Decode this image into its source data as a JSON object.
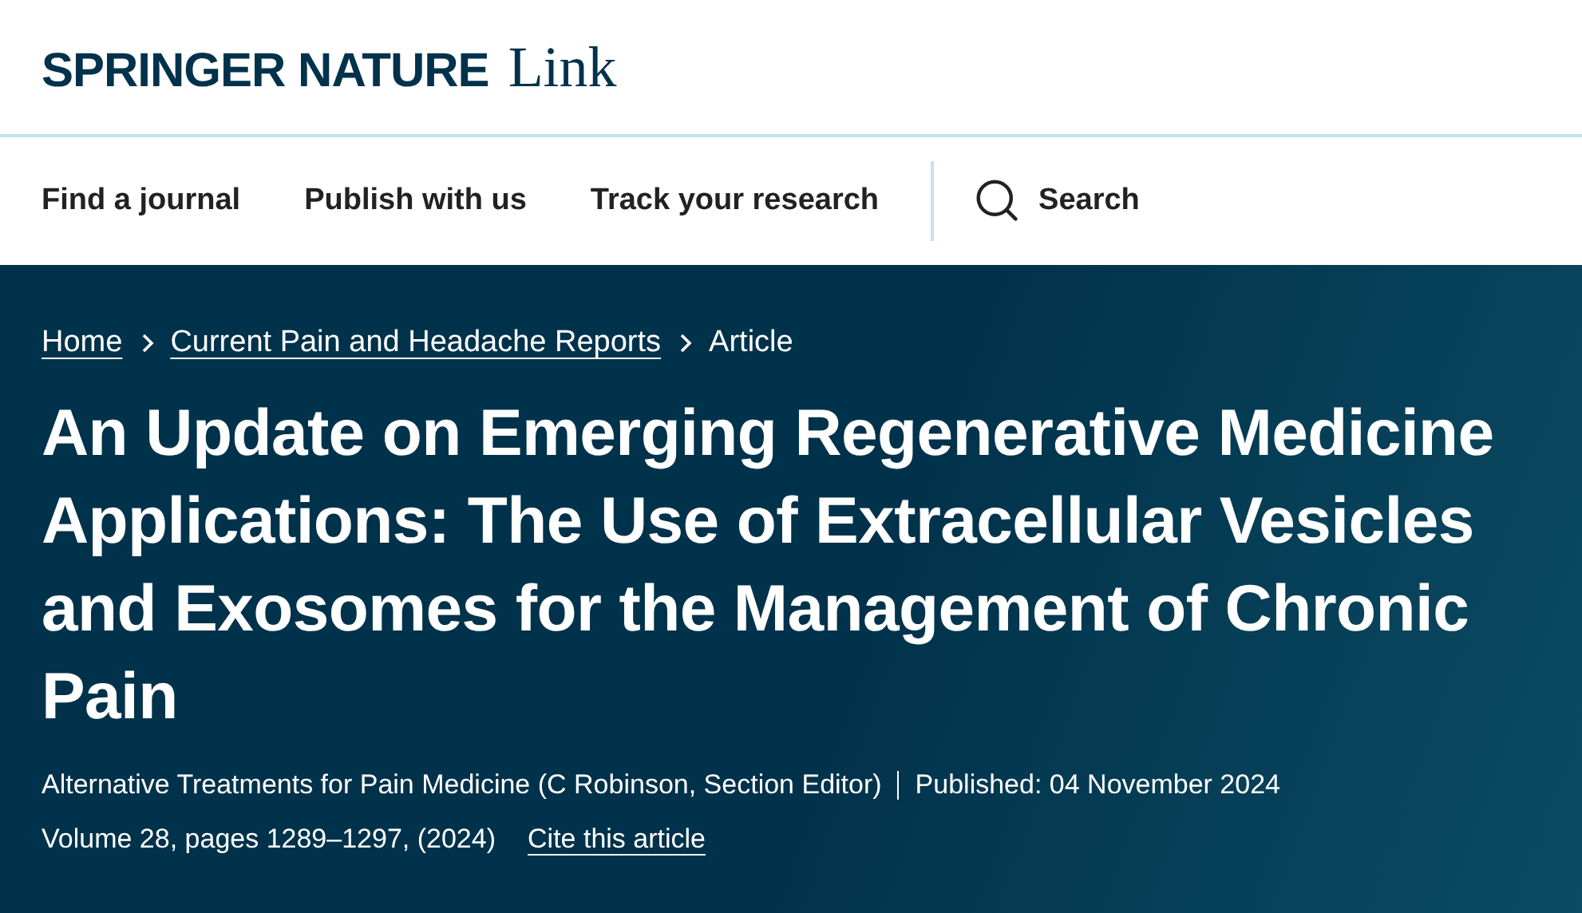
{
  "logo": {
    "brand": "SPRINGER NATURE",
    "product": "Link"
  },
  "nav": {
    "items": [
      "Find a journal",
      "Publish with us",
      "Track your research"
    ],
    "search": "Search"
  },
  "breadcrumbs": [
    {
      "label": "Home",
      "kind": "link"
    },
    {
      "label": "Current Pain and Headache Reports",
      "kind": "link"
    },
    {
      "label": "Article",
      "kind": "current"
    }
  ],
  "article": {
    "title": "An Update on Emerging Regenerative Medicine Applications: The Use of Extracellular Vesicles and Exosomes for the Management of Chronic Pain",
    "section": "Alternative Treatments for Pain Medicine (C Robinson, Section Editor)",
    "published": "Published: 04 November 2024",
    "volume": "Volume 28, pages 1289–1297, (2024)",
    "cite": "Cite this article"
  }
}
